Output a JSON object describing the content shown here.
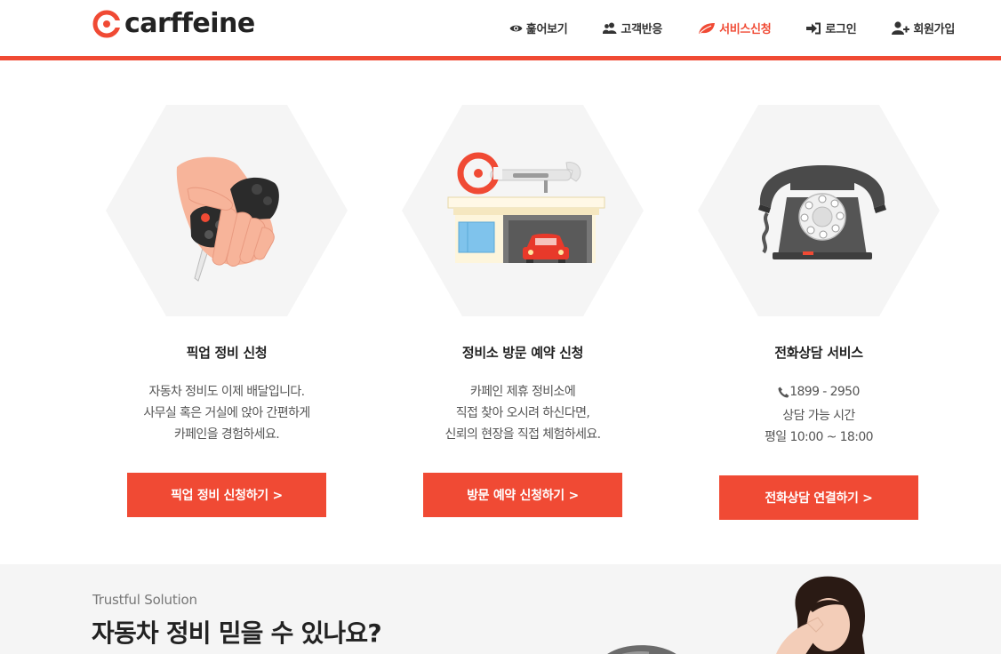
{
  "header": {
    "logo_text": "carffeine",
    "nav": [
      {
        "label": "훑어보기",
        "icon": "eye-icon"
      },
      {
        "label": "고객반응",
        "icon": "users-icon"
      },
      {
        "label": "서비스신청",
        "icon": "leaf-icon",
        "active": true
      },
      {
        "label": "로그인",
        "icon": "sign-in-icon"
      },
      {
        "label": "회원가입",
        "icon": "user-plus-icon"
      }
    ]
  },
  "colors": {
    "accent": "#f04a34",
    "hex_bg": "#f5f5f5",
    "text_dark": "#222222"
  },
  "services": [
    {
      "title": "픽업 정비 신청",
      "desc": [
        "자동차 정비도 이제 배달입니다.",
        "사무실 혹은 거실에 앉아 간편하게",
        "카페인을 경험하세요."
      ],
      "button": "픽업 정비 신청하기 >",
      "icon": "hand-car-key-icon"
    },
    {
      "title": "정비소 방문 예약 신청",
      "desc": [
        "카페인 제휴 정비소에",
        "직접 찾아 오시려 하신다면,",
        "신뢰의 현장을 직접 체험하세요."
      ],
      "button": "방문 예약 신청하기 >",
      "icon": "garage-icon"
    },
    {
      "title": "전화상담 서비스",
      "phone": "1899 - 2950",
      "desc": [
        "상담 가능 시간",
        "평일 10:00 ~ 18:00"
      ],
      "button": "전화상담 연결하기 >",
      "icon": "telephone-icon"
    }
  ],
  "bottom": {
    "subtitle": "Trustful Solution",
    "title": "자동차 정비 믿을 수 있나요?"
  }
}
